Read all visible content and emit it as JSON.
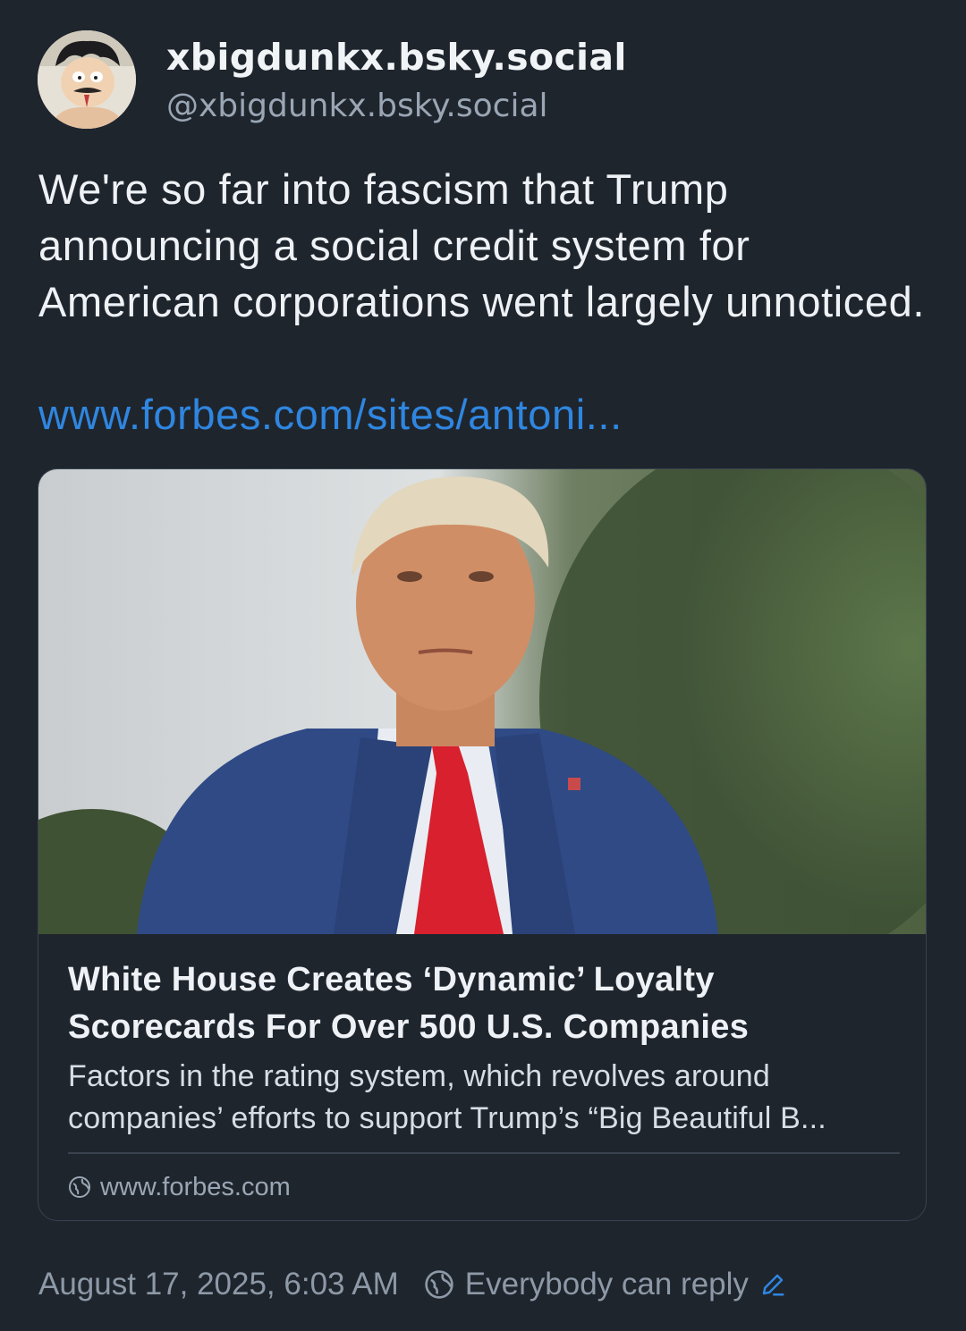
{
  "author": {
    "display_name": "xbigdunkx.bsky.social",
    "handle": "@xbigdunkx.bsky.social",
    "avatar_icon": "cartoon-avatar"
  },
  "post": {
    "text": "We're so far into fascism that Trump announcing a social credit system for American corporations went largely unnoticed.",
    "link_text": "www.forbes.com/sites/antoni..."
  },
  "link_card": {
    "image_icon": "article-photo",
    "title": "White House Creates ‘Dynamic’ Loyalty Scorecards For Over 500 U.S. Companies",
    "description": "Factors in the rating system, which revolves around companies’ efforts to support Trump’s “Big Beautiful B...",
    "domain": "www.forbes.com",
    "domain_icon": "globe-icon"
  },
  "footer": {
    "timestamp": "August 17, 2025, 6:03 AM",
    "reply_setting": "Everybody can reply",
    "reply_icon": "globe-icon",
    "edit_icon": "pencil-icon"
  },
  "colors": {
    "background": "#1f252d",
    "link": "#2f86e0",
    "muted_text": "#8d99a7",
    "border": "#39424e"
  }
}
